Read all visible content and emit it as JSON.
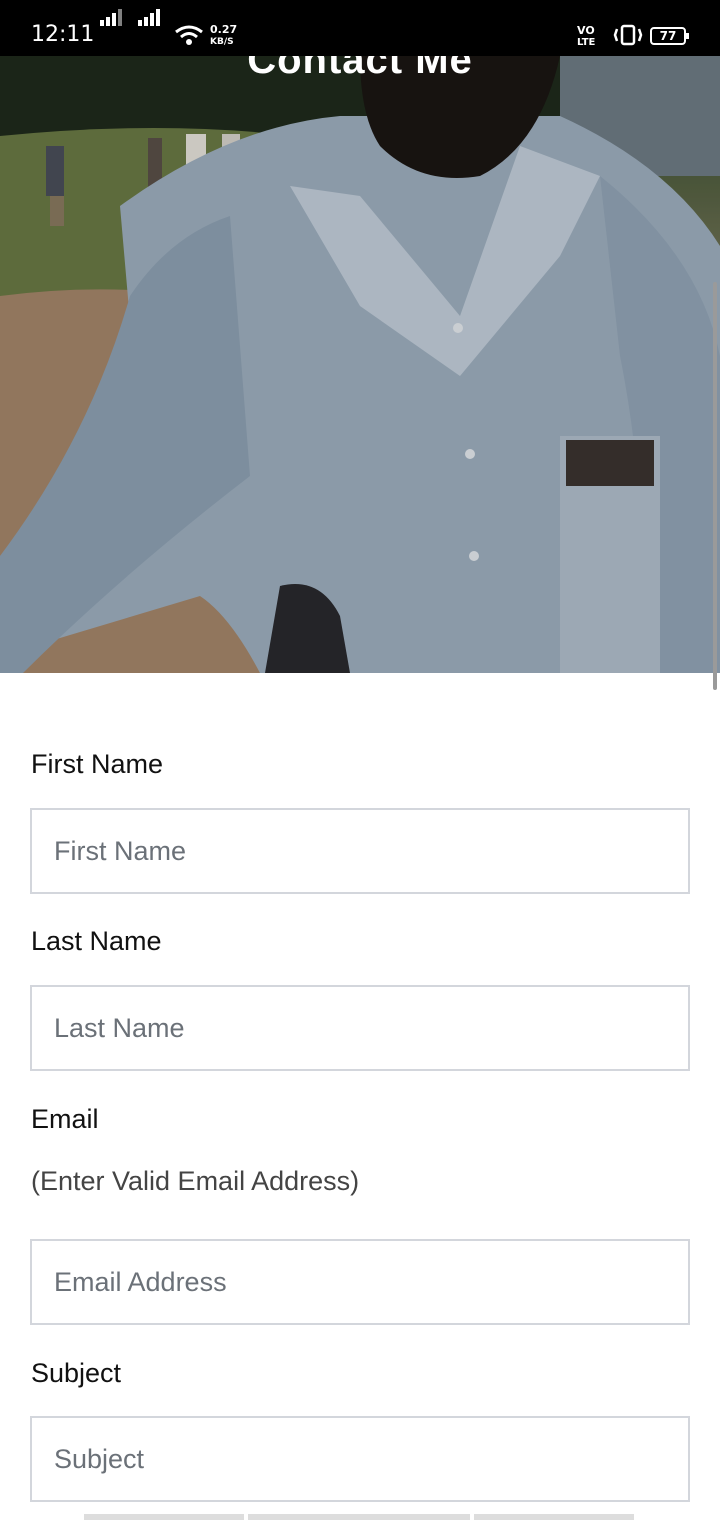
{
  "status_bar": {
    "time": "12:11",
    "net_speed_value": "0.27",
    "net_speed_unit": "KB/S",
    "volte_top": "VO",
    "volte_bottom": "LTE",
    "battery": "77"
  },
  "hero": {
    "title": "Contact Me"
  },
  "form": {
    "first_name": {
      "label": "First Name",
      "placeholder": "First Name"
    },
    "last_name": {
      "label": "Last Name",
      "placeholder": "Last Name"
    },
    "email": {
      "label": "Email",
      "hint": "(Enter Valid Email Address)",
      "placeholder": "Email Address"
    },
    "subject": {
      "label": "Subject",
      "placeholder": "Subject"
    }
  }
}
